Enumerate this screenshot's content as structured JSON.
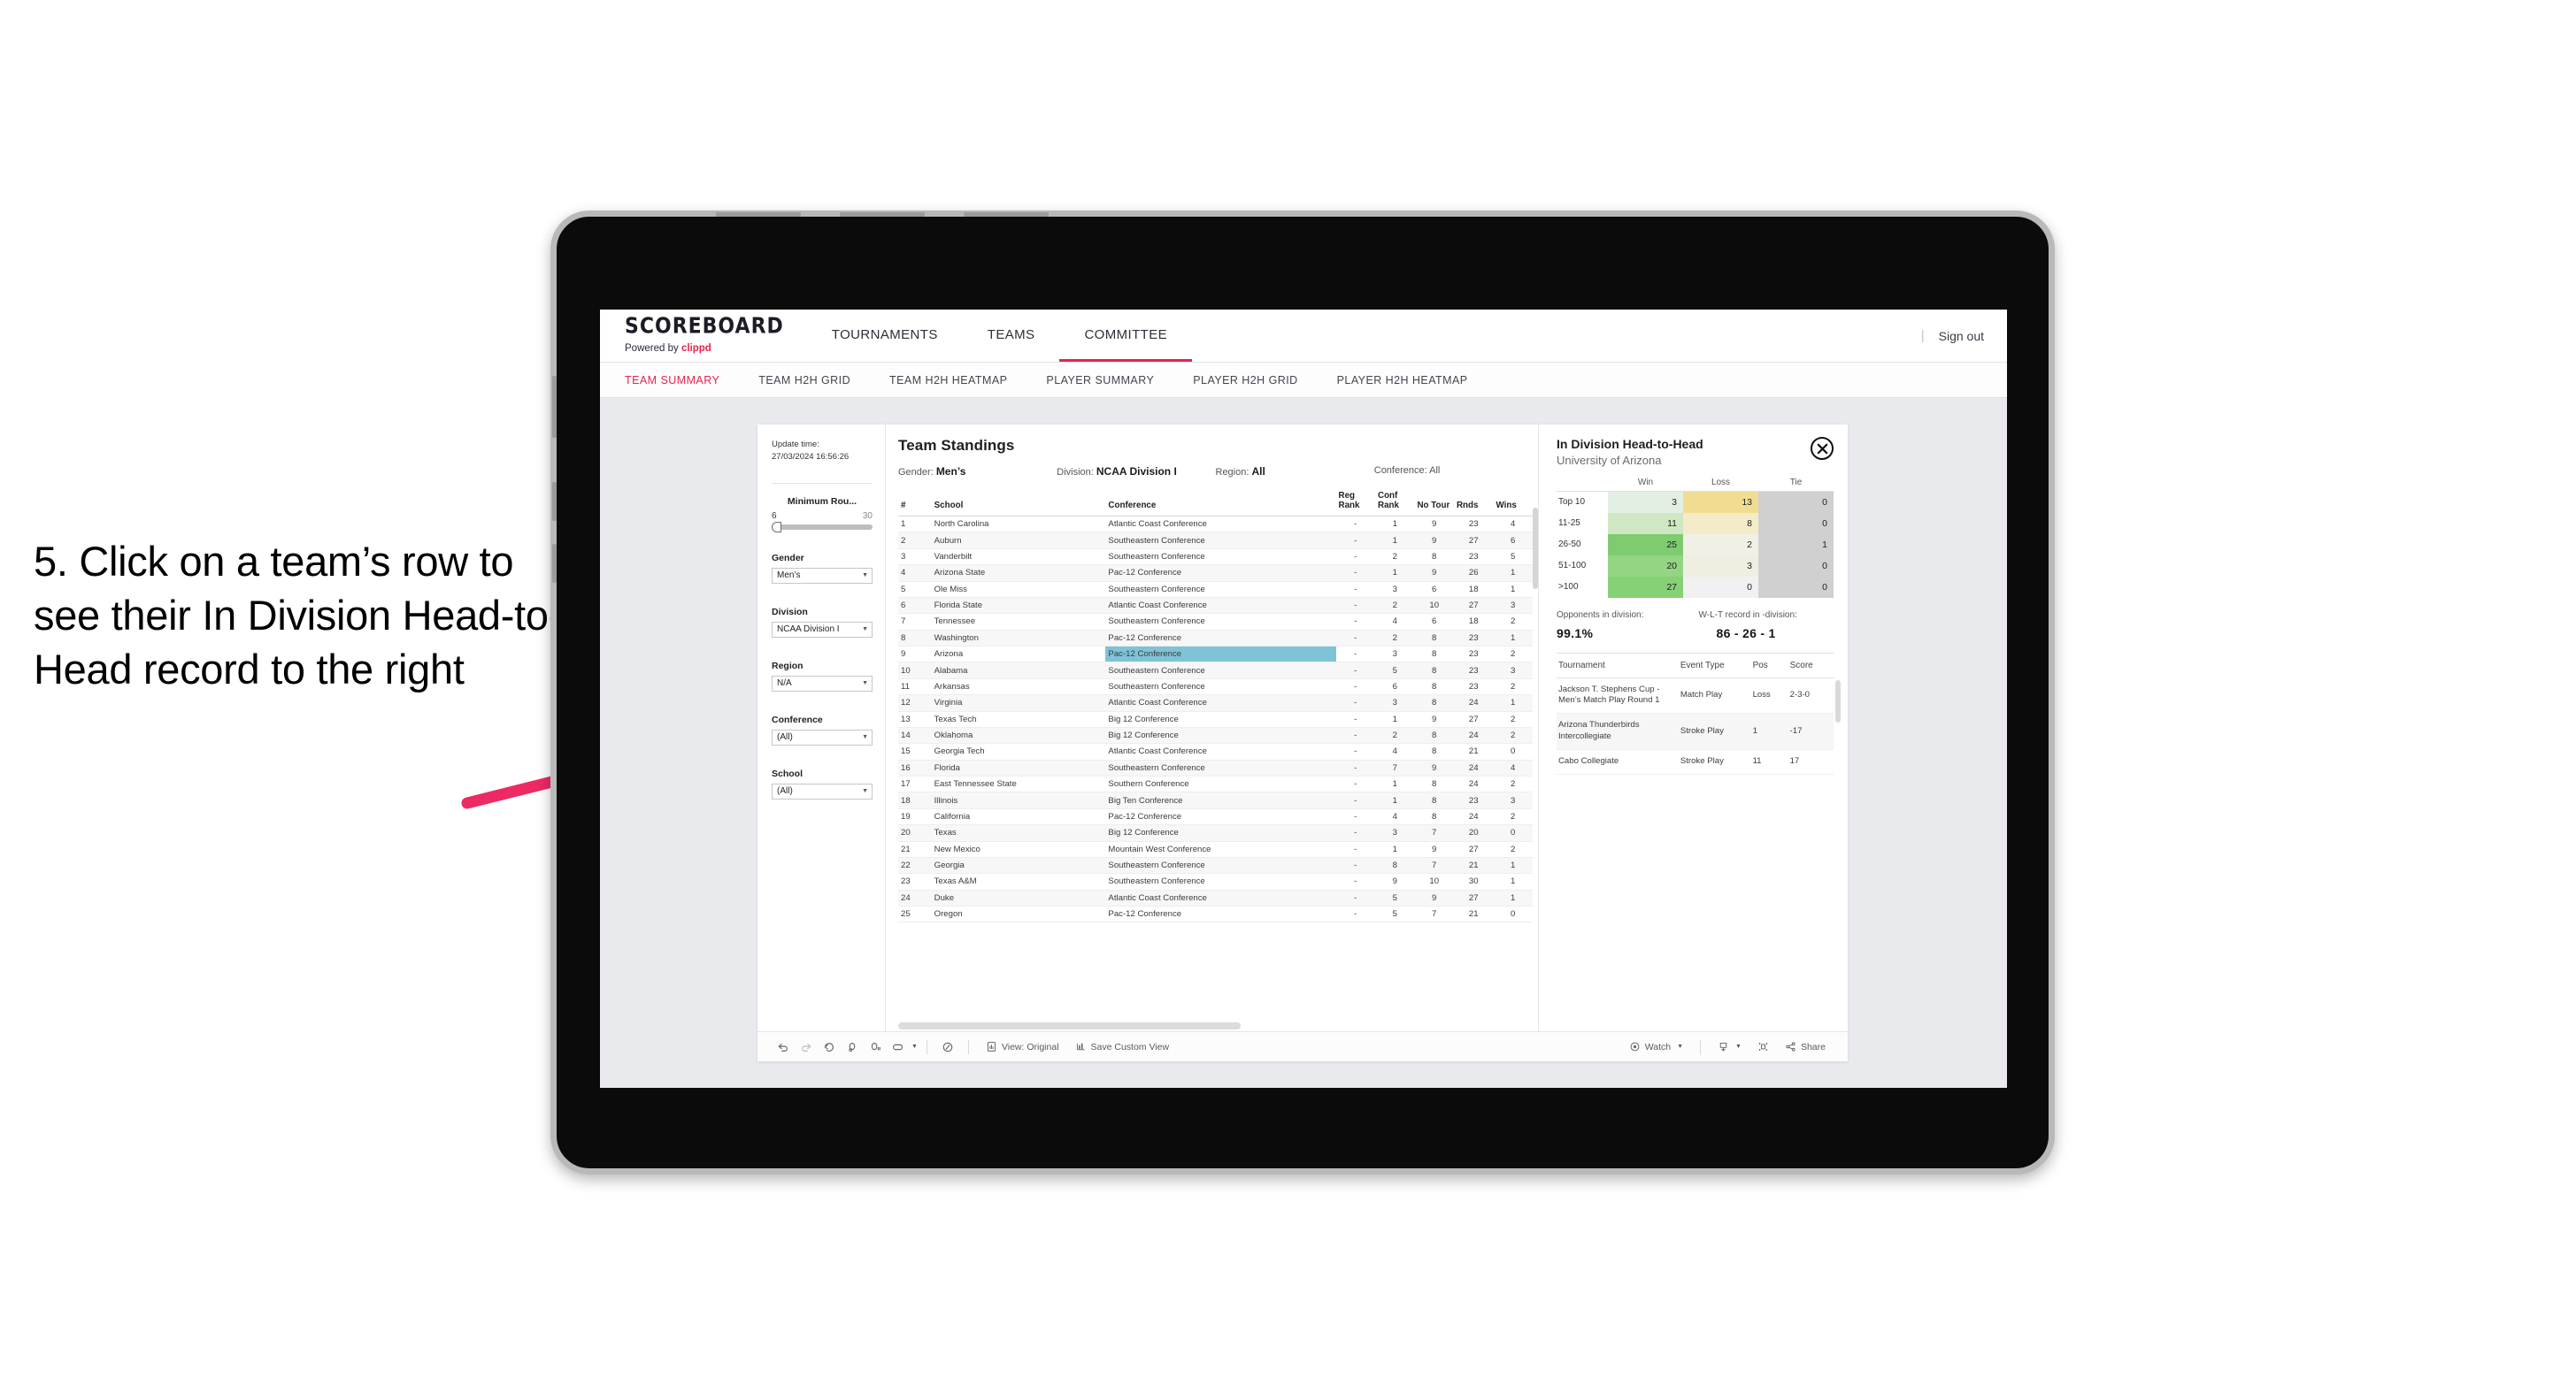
{
  "annotation": {
    "text": "5. Click on a team’s row to see their In Division Head-to-Head record to the right",
    "arrow_color": "#ED2A63"
  },
  "app": {
    "brand": {
      "title": "SCOREBOARD",
      "powered_prefix": "Powered by ",
      "powered_brand": "clippd"
    },
    "top_nav": [
      {
        "label": "TOURNAMENTS",
        "active": false
      },
      {
        "label": "TEAMS",
        "active": false
      },
      {
        "label": "COMMITTEE",
        "active": true
      }
    ],
    "sign_out": "Sign out",
    "divider": "|",
    "sub_nav": [
      {
        "label": "TEAM SUMMARY",
        "active": true
      },
      {
        "label": "TEAM H2H GRID",
        "active": false
      },
      {
        "label": "TEAM H2H HEATMAP",
        "active": false
      },
      {
        "label": "PLAYER SUMMARY",
        "active": false
      },
      {
        "label": "PLAYER H2H GRID",
        "active": false
      },
      {
        "label": "PLAYER H2H HEATMAP",
        "active": false
      }
    ]
  },
  "rail": {
    "update_label": "Update time:",
    "update_value": "27/03/2024 16:56:26",
    "min_rounds": {
      "label": "Minimum Rou...",
      "min": "6",
      "max": "30"
    },
    "filters": [
      {
        "label": "Gender",
        "value": "Men’s"
      },
      {
        "label": "Division",
        "value": "NCAA Division I"
      },
      {
        "label": "Region",
        "value": "N/A"
      },
      {
        "label": "Conference",
        "value": "(All)"
      },
      {
        "label": "School",
        "value": "(All)"
      }
    ]
  },
  "standings": {
    "title": "Team Standings",
    "meta": [
      {
        "label": "Gender:",
        "value": "Men’s"
      },
      {
        "label": "Division:",
        "value": "NCAA Division I"
      },
      {
        "label": "Region:",
        "value": "All"
      },
      {
        "label": "Conference:",
        "value": "All"
      }
    ],
    "columns": [
      "#",
      "School",
      "Conference",
      "Reg Rank",
      "Conf Rank",
      "No Tour",
      "Rnds",
      "Wins"
    ],
    "rows": [
      {
        "rank": "1",
        "school": "North Carolina",
        "conference": "Atlantic Coast Conference",
        "reg": "-",
        "conf": "1",
        "notour": "9",
        "rnds": "23",
        "wins": "4",
        "selected": false
      },
      {
        "rank": "2",
        "school": "Auburn",
        "conference": "Southeastern Conference",
        "reg": "-",
        "conf": "1",
        "notour": "9",
        "rnds": "27",
        "wins": "6",
        "selected": false
      },
      {
        "rank": "3",
        "school": "Vanderbilt",
        "conference": "Southeastern Conference",
        "reg": "-",
        "conf": "2",
        "notour": "8",
        "rnds": "23",
        "wins": "5",
        "selected": false
      },
      {
        "rank": "4",
        "school": "Arizona State",
        "conference": "Pac-12 Conference",
        "reg": "-",
        "conf": "1",
        "notour": "9",
        "rnds": "26",
        "wins": "1",
        "selected": false
      },
      {
        "rank": "5",
        "school": "Ole Miss",
        "conference": "Southeastern Conference",
        "reg": "-",
        "conf": "3",
        "notour": "6",
        "rnds": "18",
        "wins": "1",
        "selected": false
      },
      {
        "rank": "6",
        "school": "Florida State",
        "conference": "Atlantic Coast Conference",
        "reg": "-",
        "conf": "2",
        "notour": "10",
        "rnds": "27",
        "wins": "3",
        "selected": false
      },
      {
        "rank": "7",
        "school": "Tennessee",
        "conference": "Southeastern Conference",
        "reg": "-",
        "conf": "4",
        "notour": "6",
        "rnds": "18",
        "wins": "2",
        "selected": false
      },
      {
        "rank": "8",
        "school": "Washington",
        "conference": "Pac-12 Conference",
        "reg": "-",
        "conf": "2",
        "notour": "8",
        "rnds": "23",
        "wins": "1",
        "selected": false
      },
      {
        "rank": "9",
        "school": "Arizona",
        "conference": "Pac-12 Conference",
        "reg": "-",
        "conf": "3",
        "notour": "8",
        "rnds": "23",
        "wins": "2",
        "selected": true
      },
      {
        "rank": "10",
        "school": "Alabama",
        "conference": "Southeastern Conference",
        "reg": "-",
        "conf": "5",
        "notour": "8",
        "rnds": "23",
        "wins": "3",
        "selected": false
      },
      {
        "rank": "11",
        "school": "Arkansas",
        "conference": "Southeastern Conference",
        "reg": "-",
        "conf": "6",
        "notour": "8",
        "rnds": "23",
        "wins": "2",
        "selected": false
      },
      {
        "rank": "12",
        "school": "Virginia",
        "conference": "Atlantic Coast Conference",
        "reg": "-",
        "conf": "3",
        "notour": "8",
        "rnds": "24",
        "wins": "1",
        "selected": false
      },
      {
        "rank": "13",
        "school": "Texas Tech",
        "conference": "Big 12 Conference",
        "reg": "-",
        "conf": "1",
        "notour": "9",
        "rnds": "27",
        "wins": "2",
        "selected": false
      },
      {
        "rank": "14",
        "school": "Oklahoma",
        "conference": "Big 12 Conference",
        "reg": "-",
        "conf": "2",
        "notour": "8",
        "rnds": "24",
        "wins": "2",
        "selected": false
      },
      {
        "rank": "15",
        "school": "Georgia Tech",
        "conference": "Atlantic Coast Conference",
        "reg": "-",
        "conf": "4",
        "notour": "8",
        "rnds": "21",
        "wins": "0",
        "selected": false
      },
      {
        "rank": "16",
        "school": "Florida",
        "conference": "Southeastern Conference",
        "reg": "-",
        "conf": "7",
        "notour": "9",
        "rnds": "24",
        "wins": "4",
        "selected": false
      },
      {
        "rank": "17",
        "school": "East Tennessee State",
        "conference": "Southern Conference",
        "reg": "-",
        "conf": "1",
        "notour": "8",
        "rnds": "24",
        "wins": "2",
        "selected": false
      },
      {
        "rank": "18",
        "school": "Illinois",
        "conference": "Big Ten Conference",
        "reg": "-",
        "conf": "1",
        "notour": "8",
        "rnds": "23",
        "wins": "3",
        "selected": false
      },
      {
        "rank": "19",
        "school": "California",
        "conference": "Pac-12 Conference",
        "reg": "-",
        "conf": "4",
        "notour": "8",
        "rnds": "24",
        "wins": "2",
        "selected": false
      },
      {
        "rank": "20",
        "school": "Texas",
        "conference": "Big 12 Conference",
        "reg": "-",
        "conf": "3",
        "notour": "7",
        "rnds": "20",
        "wins": "0",
        "selected": false
      },
      {
        "rank": "21",
        "school": "New Mexico",
        "conference": "Mountain West Conference",
        "reg": "-",
        "conf": "1",
        "notour": "9",
        "rnds": "27",
        "wins": "2",
        "selected": false
      },
      {
        "rank": "22",
        "school": "Georgia",
        "conference": "Southeastern Conference",
        "reg": "-",
        "conf": "8",
        "notour": "7",
        "rnds": "21",
        "wins": "1",
        "selected": false
      },
      {
        "rank": "23",
        "school": "Texas A&M",
        "conference": "Southeastern Conference",
        "reg": "-",
        "conf": "9",
        "notour": "10",
        "rnds": "30",
        "wins": "1",
        "selected": false
      },
      {
        "rank": "24",
        "school": "Duke",
        "conference": "Atlantic Coast Conference",
        "reg": "-",
        "conf": "5",
        "notour": "9",
        "rnds": "27",
        "wins": "1",
        "selected": false
      },
      {
        "rank": "25",
        "school": "Oregon",
        "conference": "Pac-12 Conference",
        "reg": "-",
        "conf": "5",
        "notour": "7",
        "rnds": "21",
        "wins": "0",
        "selected": false
      }
    ]
  },
  "h2h_panel": {
    "title": "In Division Head-to-Head",
    "subtitle": "University of Arizona",
    "close_icon": "close-icon",
    "opponents_label": "Opponents in division:",
    "opponents_value": "99.1%",
    "record_label": "W-L-T record in -division:",
    "record_value": "86 - 26 - 1",
    "tournaments_columns": [
      "Tournament",
      "Event Type",
      "Pos",
      "Score"
    ],
    "tournaments": [
      {
        "name": "Jackson T. Stephens Cup - Men’s Match Play Round 1",
        "type": "Match Play",
        "pos": "Loss",
        "score": "2-3-0"
      },
      {
        "name": "Arizona Thunderbirds Intercollegiate",
        "type": "Stroke Play",
        "pos": "1",
        "score": "-17"
      },
      {
        "name": "Cabo Collegiate",
        "type": "Stroke Play",
        "pos": "11",
        "score": "17"
      }
    ]
  },
  "chart_data": {
    "type": "heatmap",
    "title": "In Division Head-to-Head",
    "subtitle": "University of Arizona",
    "columns": [
      "Win",
      "Loss",
      "Tie"
    ],
    "categories": [
      "Top 10",
      "11-25",
      "26-50",
      "51-100",
      ">100"
    ],
    "series": [
      {
        "name": "Win",
        "values": [
          3,
          11,
          25,
          20,
          27
        ]
      },
      {
        "name": "Loss",
        "values": [
          13,
          8,
          2,
          3,
          0
        ]
      },
      {
        "name": "Tie",
        "values": [
          0,
          0,
          1,
          0,
          0
        ]
      }
    ],
    "cell_colors": {
      "win": [
        "#e4efe4",
        "#cfe7c2",
        "#7fcb70",
        "#94d584",
        "#86d076"
      ],
      "loss": [
        "#f0dd92",
        "#f4ecc9",
        "#f1f0e6",
        "#f0eee1",
        "#f1f1f1"
      ],
      "tie": [
        "#d0d0d0",
        "#d0d0d0",
        "#d0d0d0",
        "#d0d0d0",
        "#d0d0d0"
      ]
    },
    "legend_position": "top",
    "grid": false
  },
  "toolbar": {
    "icons": [
      "undo-icon",
      "redo-icon",
      "revert-icon",
      "refresh-icon",
      "pause-icon",
      "device-icon"
    ],
    "view_label": "View: Original",
    "save_label": "Save Custom View",
    "watch_label": "Watch",
    "share_label": "Share"
  }
}
